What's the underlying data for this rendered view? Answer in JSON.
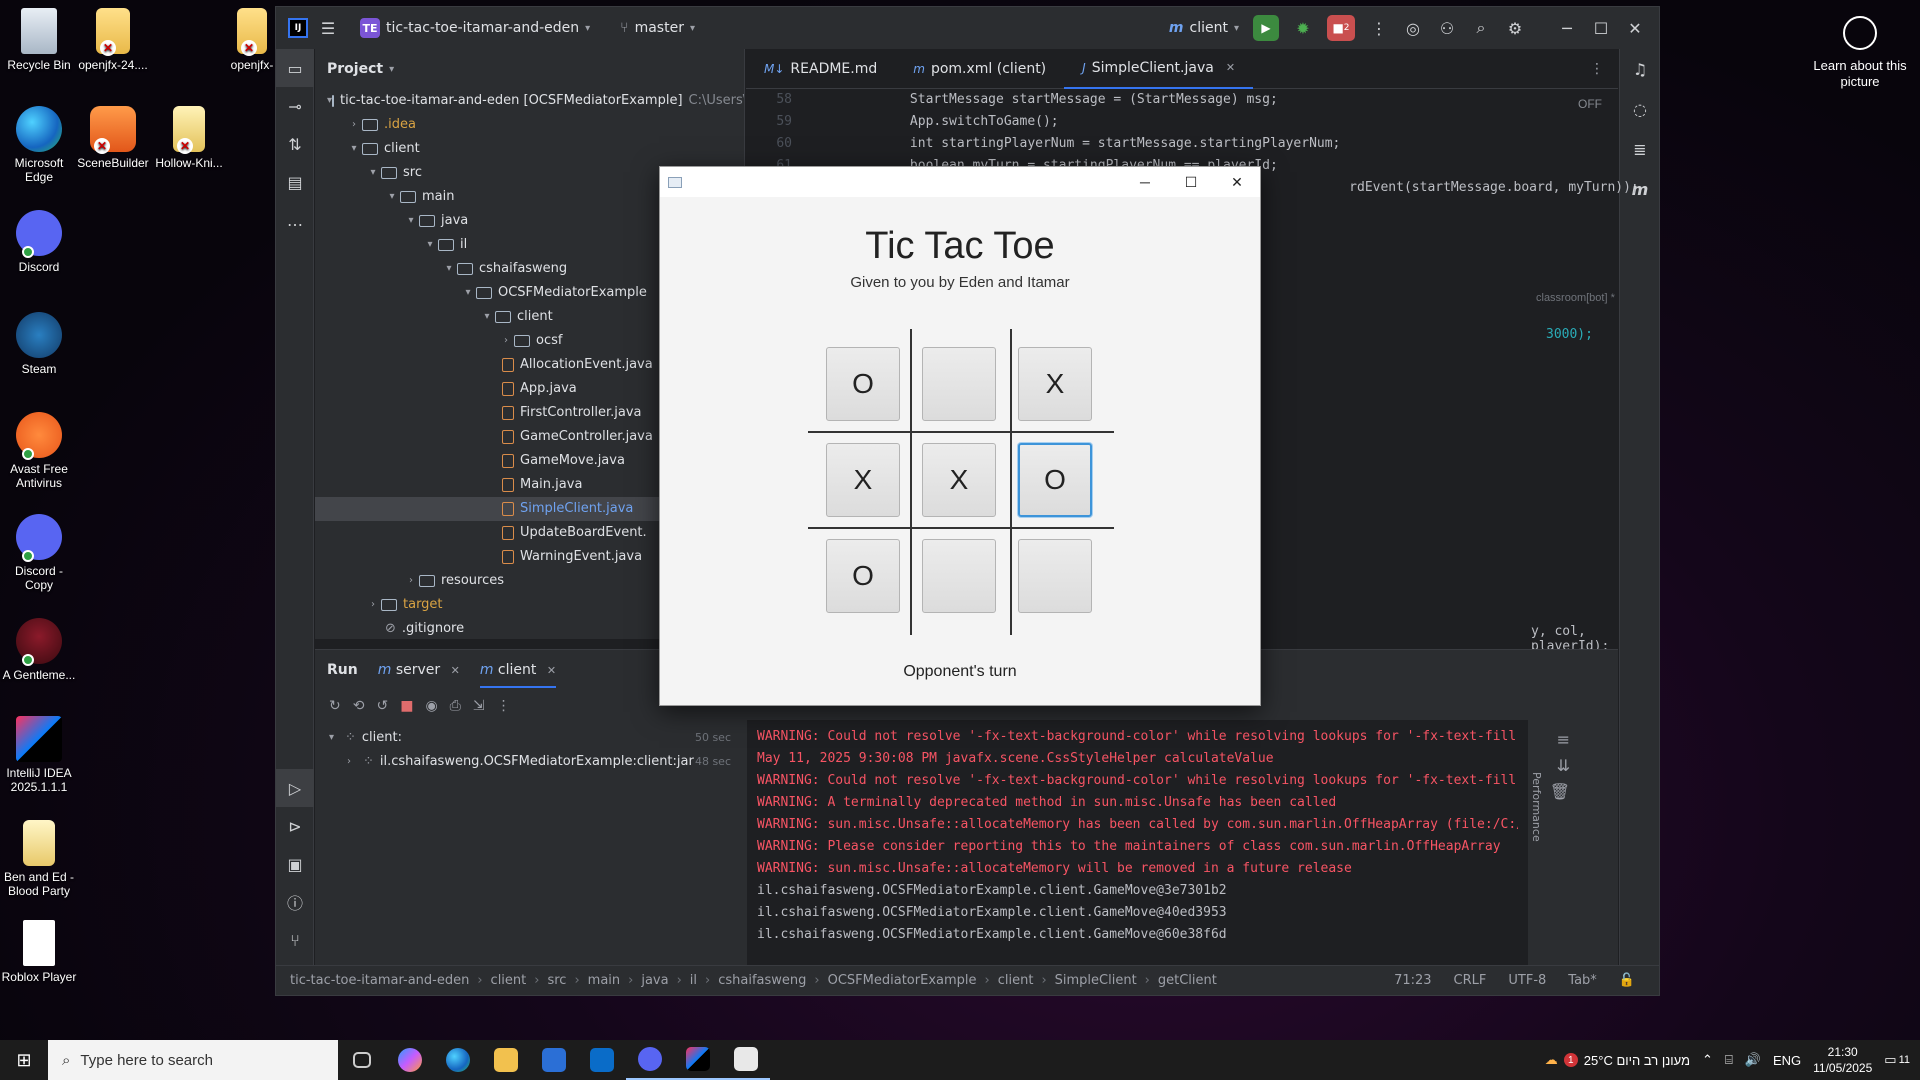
{
  "desktop": {
    "icons": [
      {
        "label": "Recycle Bin"
      },
      {
        "label": "openjfx-24...."
      },
      {
        "label": "openjfx-"
      },
      {
        "label": "Microsoft Edge"
      },
      {
        "label": "SceneBuilder"
      },
      {
        "label": "Hollow-Kni..."
      },
      {
        "label": "Discord"
      },
      {
        "label": "Steam"
      },
      {
        "label": "Avast Free Antivirus"
      },
      {
        "label": "Discord - Copy"
      },
      {
        "label": "A Gentleme..."
      },
      {
        "label": "IntelliJ IDEA 2025.1.1.1"
      },
      {
        "label": "Ben and Ed - Blood Party"
      },
      {
        "label": "Roblox Player"
      }
    ],
    "learn_label": "Learn about this picture"
  },
  "ide": {
    "project_badge": "TE",
    "project_name": "tic-tac-toe-itamar-and-eden",
    "branch": "master",
    "run_config": "client",
    "stop_count": "2",
    "project_panel_title": "Project",
    "tree": [
      {
        "label": "tic-tac-toe-itamar-and-eden [OCSFMediatorExample]",
        "path": "C:\\Users\\",
        "indent": 0,
        "kind": "folder",
        "open": true
      },
      {
        "label": ".idea",
        "indent": 1,
        "kind": "folder",
        "open": false,
        "style": "orange"
      },
      {
        "label": "client",
        "indent": 1,
        "kind": "folder",
        "open": true
      },
      {
        "label": "src",
        "indent": 2,
        "kind": "folder",
        "open": true
      },
      {
        "label": "main",
        "indent": 3,
        "kind": "folder",
        "open": true
      },
      {
        "label": "java",
        "indent": 4,
        "kind": "folder",
        "open": true
      },
      {
        "label": "il",
        "indent": 5,
        "kind": "folder",
        "open": true
      },
      {
        "label": "cshaifasweng",
        "indent": 6,
        "kind": "folder",
        "open": true
      },
      {
        "label": "OCSFMediatorExample",
        "indent": 7,
        "kind": "folder",
        "open": true
      },
      {
        "label": "client",
        "indent": 8,
        "kind": "folder",
        "open": true
      },
      {
        "label": "ocsf",
        "indent": 9,
        "kind": "folder",
        "open": false
      },
      {
        "label": "AllocationEvent.java",
        "indent": 9,
        "kind": "file"
      },
      {
        "label": "App.java",
        "indent": 9,
        "kind": "file"
      },
      {
        "label": "FirstController.java",
        "indent": 9,
        "kind": "file"
      },
      {
        "label": "GameController.java",
        "indent": 9,
        "kind": "file"
      },
      {
        "label": "GameMove.java",
        "indent": 9,
        "kind": "file"
      },
      {
        "label": "Main.java",
        "indent": 9,
        "kind": "file"
      },
      {
        "label": "SimpleClient.java",
        "indent": 9,
        "kind": "file",
        "selected": true,
        "style": "blue"
      },
      {
        "label": "UpdateBoardEvent.",
        "indent": 9,
        "kind": "file"
      },
      {
        "label": "WarningEvent.java",
        "indent": 9,
        "kind": "file"
      },
      {
        "label": "resources",
        "indent": 4,
        "kind": "folder",
        "open": false
      },
      {
        "label": "target",
        "indent": 2,
        "kind": "folder",
        "open": false,
        "style": "orange"
      },
      {
        "label": ".gitignore",
        "indent": 2,
        "kind": "ignore"
      }
    ],
    "tabs": [
      {
        "label": "README.md",
        "icon": "M↓"
      },
      {
        "label": "pom.xml (client)",
        "icon": "m"
      },
      {
        "label": "SimpleClient.java",
        "icon": "J",
        "active": true
      }
    ],
    "code_lines": [
      {
        "num": "58",
        "text": "            StartMessage startMessage = (StartMessage) msg;"
      },
      {
        "num": "59",
        "text": "            App.switchToGame();"
      },
      {
        "num": "60",
        "text": "            int startingPlayerNum = startMessage.startingPlayerNum;"
      },
      {
        "num": "61",
        "text": "            boolean myTurn = startingPlayerNum == playerId;"
      },
      {
        "num": "",
        "text": "                                                                          rdEvent(startMessage.board, myTurn));"
      }
    ],
    "code_fragments": {
      "author_hint": "classroom[bot] *",
      "timeout_frag": "3000);",
      "call_frag": "y, col, playerId);"
    },
    "editor_off_label": "OFF",
    "run_panel": {
      "title": "Run",
      "tabs": [
        "server",
        "client"
      ],
      "tree": [
        {
          "label": "client:",
          "time": "50 sec"
        },
        {
          "label": "il.cshaifasweng.OCSFMediatorExample:client:jar",
          "time": "48 sec"
        }
      ],
      "console": [
        {
          "text": "WARNING: Could not resolve '-fx-text-background-color' while resolving lookups for '-fx-text-fill'",
          "kind": "warn"
        },
        {
          "text": "May 11, 2025 9:30:08 PM javafx.scene.CssStyleHelper calculateValue",
          "kind": "warn"
        },
        {
          "text": "WARNING: Could not resolve '-fx-text-background-color' while resolving lookups for '-fx-text-fill'",
          "kind": "warn"
        },
        {
          "text": "WARNING: A terminally deprecated method in sun.misc.Unsafe has been called",
          "kind": "warn"
        },
        {
          "text": "WARNING: sun.misc.Unsafe::allocateMemory has been called by com.sun.marlin.OffHeapArray (file:/C:/U",
          "kind": "warn"
        },
        {
          "text": "WARNING: Please consider reporting this to the maintainers of class com.sun.marlin.OffHeapArray",
          "kind": "warn"
        },
        {
          "text": "WARNING: sun.misc.Unsafe::allocateMemory will be removed in a future release",
          "kind": "warn"
        },
        {
          "text": "il.cshaifasweng.OCSFMediatorExample.client.GameMove@3e7301b2",
          "kind": "norm"
        },
        {
          "text": "il.cshaifasweng.OCSFMediatorExample.client.GameMove@40ed3953",
          "kind": "norm"
        },
        {
          "text": "il.cshaifasweng.OCSFMediatorExample.client.GameMove@60e38f6d",
          "kind": "norm"
        }
      ],
      "performance_label": "Performance"
    },
    "statusbar": {
      "crumbs": [
        "tic-tac-toe-itamar-and-eden",
        "client",
        "src",
        "main",
        "java",
        "il",
        "cshaifasweng",
        "OCSFMediatorExample",
        "client",
        "SimpleClient",
        "getClient"
      ],
      "position": "71:23",
      "line_sep": "CRLF",
      "encoding": "UTF-8",
      "indent": "Tab*"
    }
  },
  "game": {
    "title": "Tic Tac Toe",
    "subtitle": "Given to you by Eden and Itamar",
    "board": [
      [
        "O",
        "",
        "X"
      ],
      [
        "X",
        "X",
        "O"
      ],
      [
        "O",
        "",
        ""
      ]
    ],
    "focused_cell": "1-2",
    "status": "Opponent's turn"
  },
  "taskbar": {
    "search_placeholder": "Type here to search",
    "weather": "25°C  מעונן רב היום",
    "weather_alert": "1",
    "lang": "ENG",
    "time": "21:30",
    "date": "11/05/2025",
    "notif_count": "11"
  }
}
